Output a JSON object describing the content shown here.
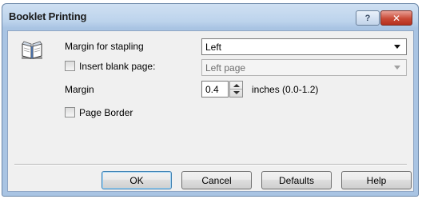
{
  "window": {
    "title": "Booklet Printing",
    "help_button": "?",
    "close_button": "✕"
  },
  "margin_for_stapling": {
    "label": "Margin for stapling",
    "value": "Left"
  },
  "insert_blank_page": {
    "label": "Insert blank page:",
    "checked": false,
    "value": "Left page"
  },
  "margin": {
    "label": "Margin",
    "value": "0.4",
    "units": "inches (0.0-1.2)"
  },
  "page_border": {
    "label": "Page Border",
    "checked": false
  },
  "buttons": {
    "ok": "OK",
    "cancel": "Cancel",
    "defaults": "Defaults",
    "help": "Help"
  }
}
